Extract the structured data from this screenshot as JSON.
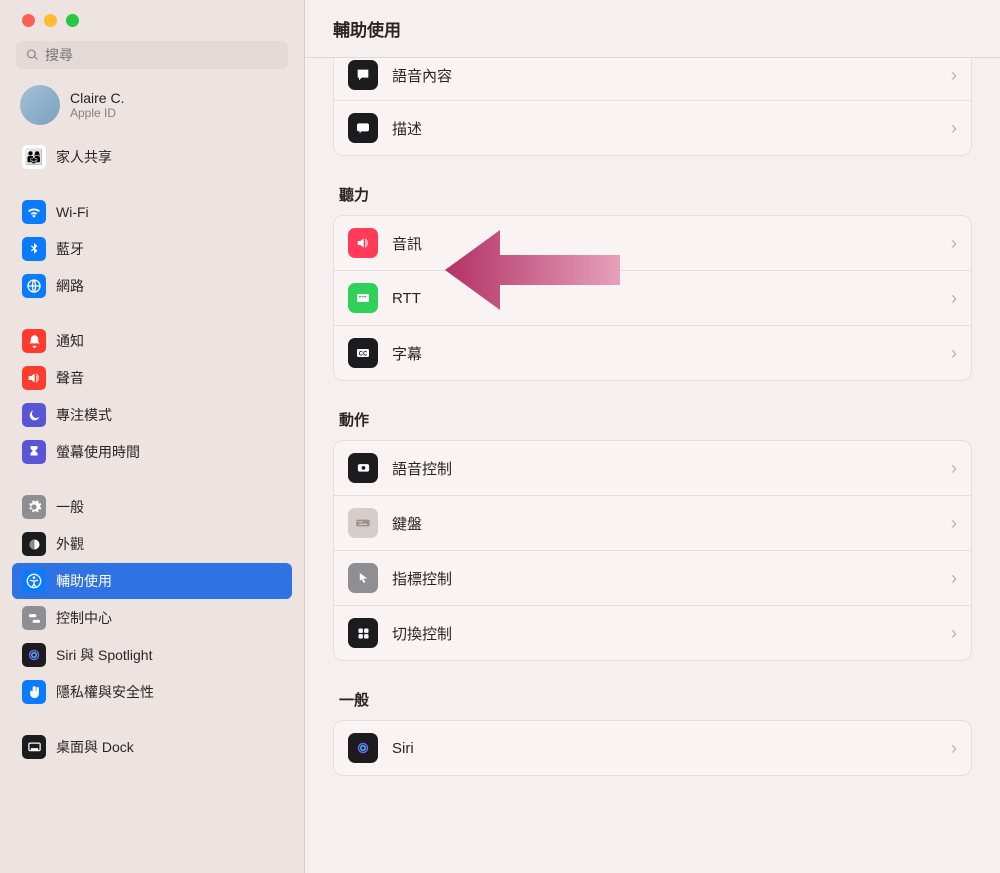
{
  "window": {
    "title": "輔助使用"
  },
  "search": {
    "placeholder": "搜尋"
  },
  "account": {
    "name": "Claire C.",
    "sub": "Apple ID"
  },
  "sidebar": {
    "items": [
      {
        "id": "family",
        "label": "家人共享",
        "bg": "#ffffff",
        "glyph": "👪"
      },
      {
        "gap": true
      },
      {
        "id": "wifi",
        "label": "Wi-Fi",
        "bg": "#0a7aff",
        "glyph": "wifi"
      },
      {
        "id": "bluetooth",
        "label": "藍牙",
        "bg": "#0a7aff",
        "glyph": "bt"
      },
      {
        "id": "network",
        "label": "網路",
        "bg": "#0a7aff",
        "glyph": "globe"
      },
      {
        "gap": true
      },
      {
        "id": "notifications",
        "label": "通知",
        "bg": "#ff3b30",
        "glyph": "bell"
      },
      {
        "id": "sound",
        "label": "聲音",
        "bg": "#ff3b30",
        "glyph": "speaker"
      },
      {
        "id": "focus",
        "label": "專注模式",
        "bg": "#5856d6",
        "glyph": "moon"
      },
      {
        "id": "screentime",
        "label": "螢幕使用時間",
        "bg": "#5856d6",
        "glyph": "hourglass"
      },
      {
        "gap": true
      },
      {
        "id": "general",
        "label": "一般",
        "bg": "#8e8e93",
        "glyph": "gear"
      },
      {
        "id": "appearance",
        "label": "外觀",
        "bg": "#1c1c1e",
        "glyph": "appearance"
      },
      {
        "id": "accessibility",
        "label": "輔助使用",
        "bg": "#0a7aff",
        "glyph": "access",
        "selected": true
      },
      {
        "id": "controlcenter",
        "label": "控制中心",
        "bg": "#8e8e93",
        "glyph": "switches"
      },
      {
        "id": "siri",
        "label": "Siri 與 Spotlight",
        "bg": "#1c1c1e",
        "glyph": "siri"
      },
      {
        "id": "privacy",
        "label": "隱私權與安全性",
        "bg": "#0a7aff",
        "glyph": "hand"
      },
      {
        "gap": true
      },
      {
        "id": "desktop",
        "label": "桌面與 Dock",
        "bg": "#1c1c1e",
        "glyph": "dock"
      }
    ]
  },
  "content": {
    "cutoff_group": [
      {
        "id": "spoken",
        "label": "語音內容",
        "bg": "#1c1c1e",
        "glyph": "bubble"
      },
      {
        "id": "descriptions",
        "label": "描述",
        "bg": "#1c1c1e",
        "glyph": "bubble2"
      }
    ],
    "sections": [
      {
        "title": "聽力",
        "rows": [
          {
            "id": "audio",
            "label": "音訊",
            "bg": "#ff3b57",
            "glyph": "speaker"
          },
          {
            "id": "rtt",
            "label": "RTT",
            "bg": "#30d158",
            "glyph": "rtt"
          },
          {
            "id": "captions",
            "label": "字幕",
            "bg": "#1c1c1e",
            "glyph": "cc"
          }
        ]
      },
      {
        "title": "動作",
        "rows": [
          {
            "id": "voicecontrol",
            "label": "語音控制",
            "bg": "#1c1c1e",
            "glyph": "mic"
          },
          {
            "id": "keyboard",
            "label": "鍵盤",
            "bg": "#d6cdcb",
            "glyph": "kbd"
          },
          {
            "id": "pointer",
            "label": "指標控制",
            "bg": "#8e8e93",
            "glyph": "cursor"
          },
          {
            "id": "switch",
            "label": "切換控制",
            "bg": "#1c1c1e",
            "glyph": "grid"
          }
        ]
      },
      {
        "title": "一般",
        "rows": [
          {
            "id": "siri2",
            "label": "Siri",
            "bg": "#1c1c1e",
            "glyph": "siri"
          }
        ]
      }
    ]
  },
  "colors": {
    "accent": "#2f72e4",
    "arrow": "#c8426f"
  }
}
